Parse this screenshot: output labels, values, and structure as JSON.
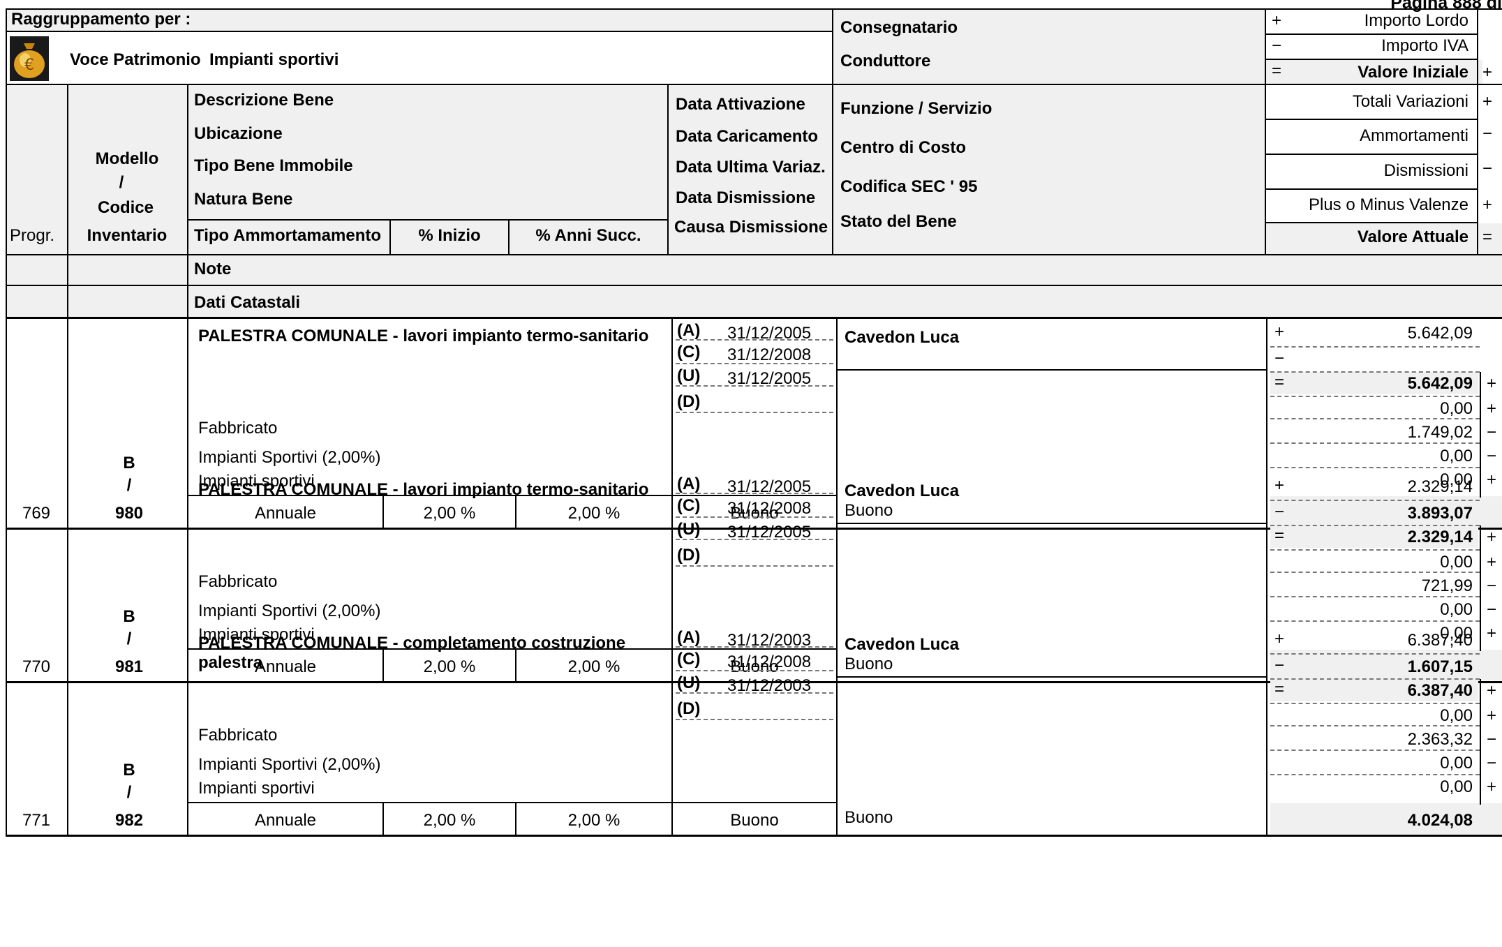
{
  "page_label": "Pagina 888 di",
  "header": {
    "grouping_label": "Raggruppamento per :",
    "voce_label": "Voce Patrimonio",
    "voce_value": "Impianti sportivi",
    "consegnatario": "Consegnatario",
    "conduttore": "Conduttore",
    "importo_lordo": "Importo Lordo",
    "importo_iva": "Importo IVA",
    "valore_iniziale": "Valore Iniziale",
    "totali_variazioni": "Totali Variazioni",
    "ammortamenti": "Ammortamenti",
    "dismissioni": "Dismissioni",
    "plus_minus": "Plus o Minus Valenze",
    "valore_attuale": "Valore Attuale",
    "progr": "Progr.",
    "modello": "Modello",
    "slash": "/",
    "codice": "Codice",
    "inventario": "Inventario",
    "descrizione_bene": "Descrizione Bene",
    "ubicazione": "Ubicazione",
    "tipo_bene": "Tipo Bene Immobile",
    "natura_bene": "Natura Bene",
    "tipo_ammortamento": "Tipo  Ammortamamento",
    "perc_inizio": "% Inizio",
    "perc_anni": "% Anni Succ.",
    "data_attivazione": "Data Attivazione",
    "data_caricamento": "Data Caricamento",
    "data_ultima": "Data Ultima Variaz.",
    "data_dismissione": "Data Dismissione",
    "causa_dismissione": "Causa Dismissione",
    "funzione_servizio": "Funzione / Servizio",
    "centro_costo": "Centro di Costo",
    "codifica_sec": "Codifica SEC ' 95",
    "stato_bene": "Stato del Bene",
    "note": "Note",
    "dati_catastali": "Dati Catastali"
  },
  "signs": {
    "plus": "+",
    "minus": "−",
    "equals": "="
  },
  "date_codes": {
    "a": "(A)",
    "c": "(C)",
    "u": "(U)",
    "d": "(D)"
  },
  "records": [
    {
      "progr": "769",
      "model": "B",
      "slash": "/",
      "code": "980",
      "description": "PALESTRA COMUNALE - lavori impianto termo-sanitario",
      "description2": "",
      "tipo_bene": "Fabbricato",
      "natura": "Impianti Sportivi (2,00%)",
      "natura2": "Impianti sportivi",
      "ammortamento": "Annuale",
      "inizio": "2,00 %",
      "anni": "2,00 %",
      "date_a": "31/12/2005",
      "date_c": "31/12/2008",
      "date_u": "31/12/2005",
      "date_d": "",
      "causa": "Buono",
      "consegnatario": "Cavedon Luca",
      "stato": "Buono",
      "importo_lordo": "5.642,09",
      "importo_iva": "",
      "valore_iniziale": "5.642,09",
      "variazioni": "0,00",
      "ammortamenti": "1.749,02",
      "dismissioni": "0,00",
      "plusminus": "0,00",
      "valore_attuale": "3.893,07"
    },
    {
      "progr": "770",
      "model": "B",
      "slash": "/",
      "code": "981",
      "description": "PALESTRA COMUNALE - lavori impianto termo-sanitario",
      "description2": "",
      "tipo_bene": "Fabbricato",
      "natura": "Impianti Sportivi (2,00%)",
      "natura2": "Impianti sportivi",
      "ammortamento": "Annuale",
      "inizio": "2,00 %",
      "anni": "2,00 %",
      "date_a": "31/12/2005",
      "date_c": "31/12/2008",
      "date_u": "31/12/2005",
      "date_d": "",
      "causa": "Buono",
      "consegnatario": "Cavedon Luca",
      "stato": "Buono",
      "importo_lordo": "2.329,14",
      "importo_iva": "",
      "valore_iniziale": "2.329,14",
      "variazioni": "0,00",
      "ammortamenti": "721,99",
      "dismissioni": "0,00",
      "plusminus": "0,00",
      "valore_attuale": "1.607,15"
    },
    {
      "progr": "771",
      "model": "B",
      "slash": "/",
      "code": "982",
      "description": "PALESTRA COMUNALE - completamento costruzione",
      "description2": "palestra",
      "tipo_bene": "Fabbricato",
      "natura": "Impianti Sportivi (2,00%)",
      "natura2": "Impianti sportivi",
      "ammortamento": "Annuale",
      "inizio": "2,00 %",
      "anni": "2,00 %",
      "date_a": "31/12/2003",
      "date_c": "31/12/2008",
      "date_u": "31/12/2003",
      "date_d": "",
      "causa": "Buono",
      "consegnatario": "Cavedon Luca",
      "stato": "Buono",
      "importo_lordo": "6.387,40",
      "importo_iva": "",
      "valore_iniziale": "6.387,40",
      "variazioni": "0,00",
      "ammortamenti": "2.363,32",
      "dismissioni": "0,00",
      "plusminus": "0,00",
      "valore_attuale": "4.024,08"
    }
  ]
}
